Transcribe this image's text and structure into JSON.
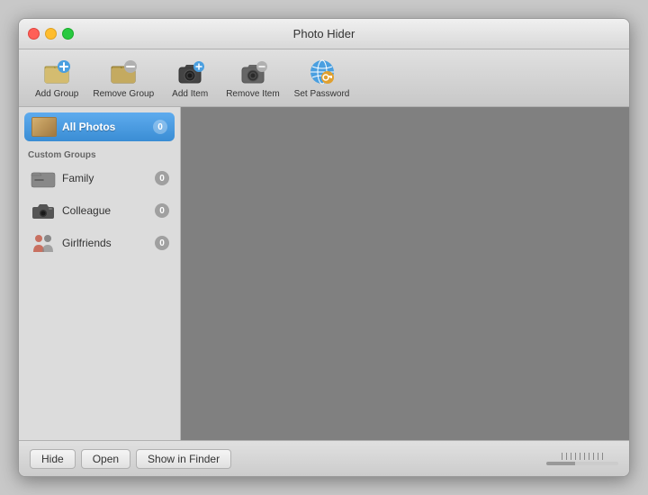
{
  "window": {
    "title": "Photo Hider"
  },
  "toolbar": {
    "items": [
      {
        "id": "add-group",
        "label": "Add Group"
      },
      {
        "id": "remove-group",
        "label": "Remove Group"
      },
      {
        "id": "add-item",
        "label": "Add Item"
      },
      {
        "id": "remove-item",
        "label": "Remove Item"
      },
      {
        "id": "set-password",
        "label": "Set Password"
      }
    ]
  },
  "sidebar": {
    "all_photos_label": "All Photos",
    "all_photos_badge": "0",
    "section_label": "Custom Groups",
    "groups": [
      {
        "name": "Family",
        "badge": "0"
      },
      {
        "name": "Colleague",
        "badge": "0"
      },
      {
        "name": "Girlfriends",
        "badge": "0"
      }
    ]
  },
  "bottom_bar": {
    "hide_label": "Hide",
    "open_label": "Open",
    "show_in_finder_label": "Show in Finder"
  }
}
